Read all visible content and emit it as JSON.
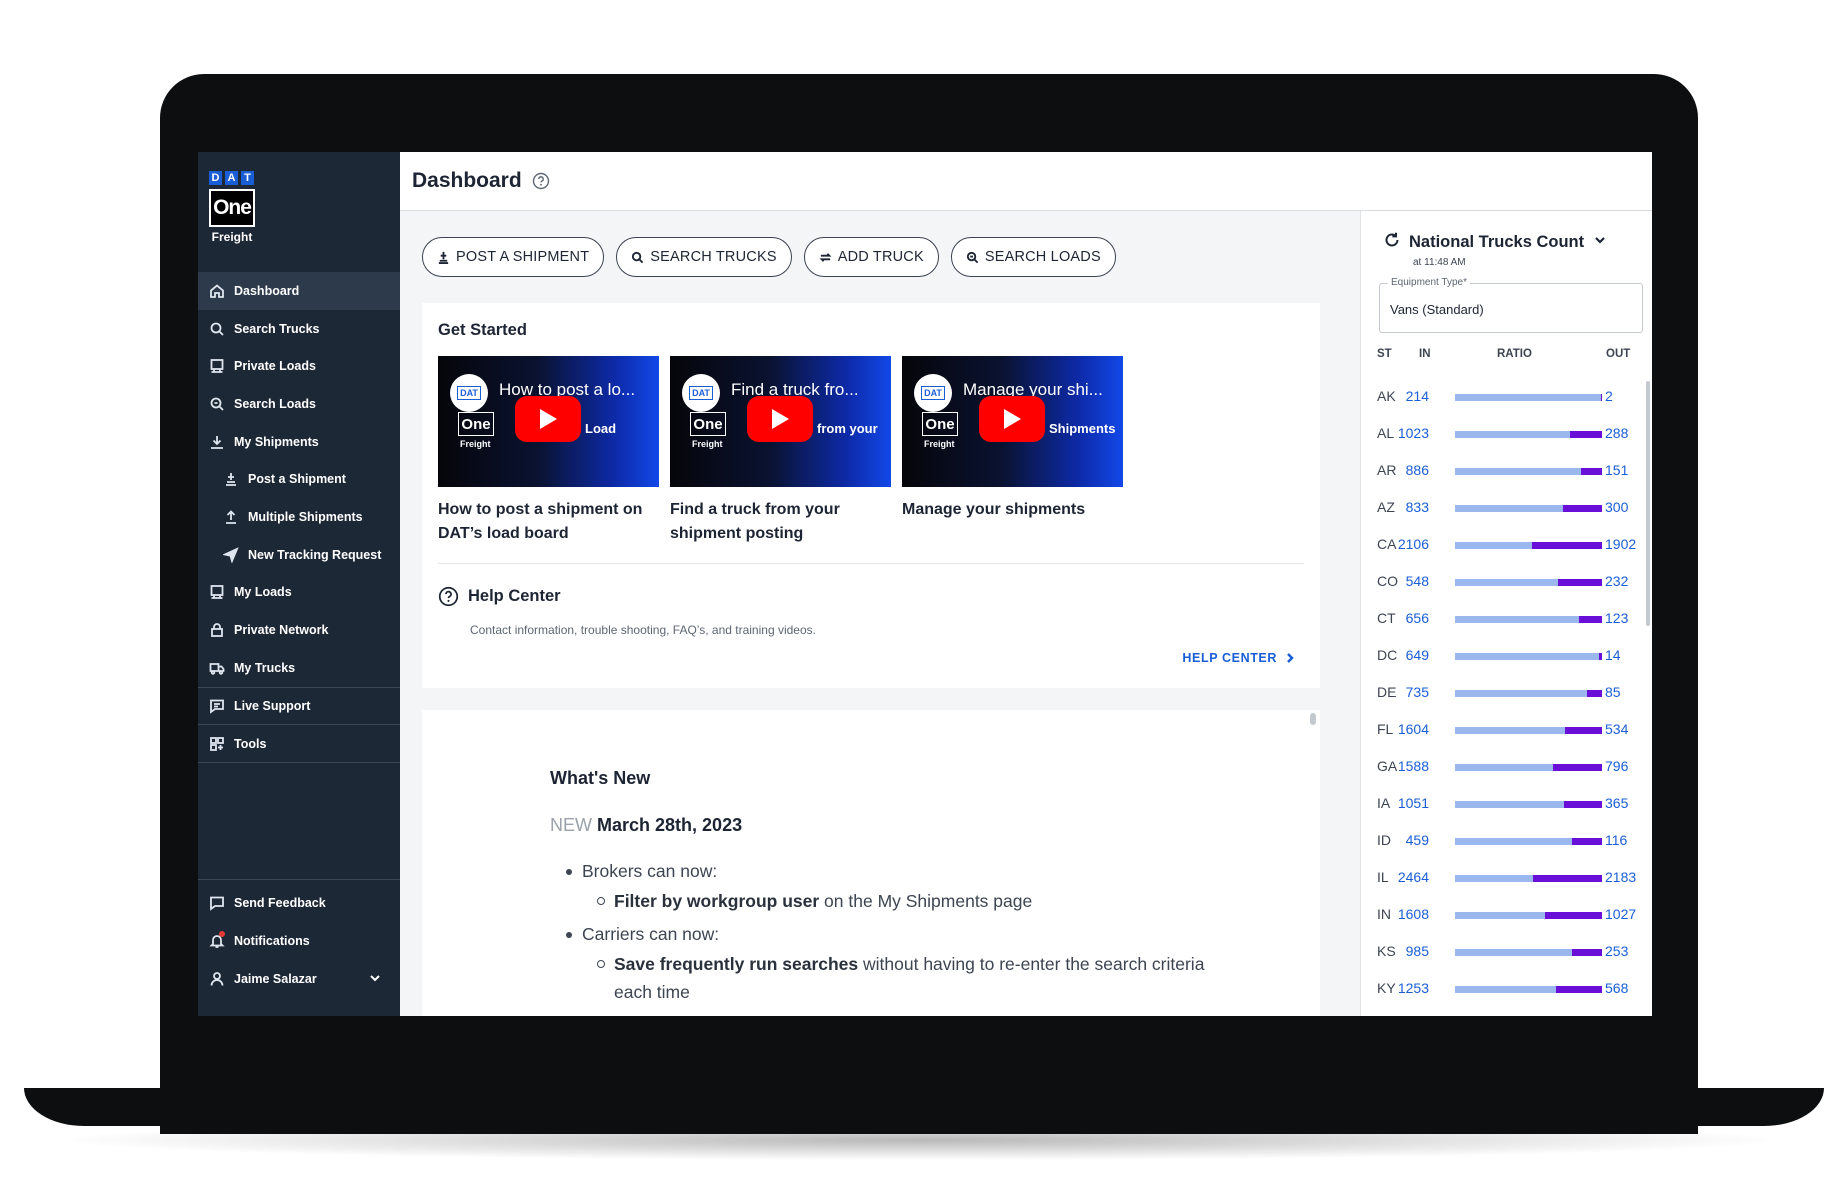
{
  "sidebar": {
    "logo": {
      "dat": [
        "D",
        "A",
        "T"
      ],
      "one": "One",
      "freight": "Freight"
    },
    "items": [
      {
        "label": "Dashboard",
        "icon": "home-icon",
        "active": true
      },
      {
        "label": "Search Trucks",
        "icon": "search-icon"
      },
      {
        "label": "Private Loads",
        "icon": "private-loads-icon"
      },
      {
        "label": "Search Loads",
        "icon": "search-loads-icon"
      },
      {
        "label": "My Shipments",
        "icon": "shipments-icon"
      },
      {
        "label": "Post a Shipment",
        "icon": "post-shipment-icon",
        "sub": true
      },
      {
        "label": "Multiple Shipments",
        "icon": "upload-icon",
        "sub": true
      },
      {
        "label": "New Tracking Request",
        "icon": "navigation-arrow-icon",
        "sub": true
      },
      {
        "label": "My Loads",
        "icon": "my-loads-icon"
      },
      {
        "label": "Private Network",
        "icon": "lock-icon"
      },
      {
        "label": "My Trucks",
        "icon": "truck-icon"
      },
      {
        "label": "Live Support",
        "icon": "chat-icon"
      },
      {
        "label": "Tools",
        "icon": "grid-icon"
      }
    ],
    "bottom": [
      {
        "label": "Send Feedback",
        "icon": "feedback-icon"
      },
      {
        "label": "Notifications",
        "icon": "bell-icon"
      },
      {
        "label": "Jaime Salazar",
        "icon": "user-icon"
      }
    ]
  },
  "header": {
    "title": "Dashboard"
  },
  "actions": [
    {
      "label": "POST A SHIPMENT",
      "icon": "post-icon"
    },
    {
      "label": "SEARCH TRUCKS",
      "icon": "search-icon"
    },
    {
      "label": "ADD TRUCK",
      "icon": "swap-icon"
    },
    {
      "label": "SEARCH LOADS",
      "icon": "search-loads-icon"
    }
  ],
  "get_started": {
    "title": "Get Started",
    "videos": [
      {
        "thumb_title": "How to post a lo...",
        "thumb_sub": "Load",
        "caption": "How to post a shipment on DAT’s load board"
      },
      {
        "thumb_title": "Find a truck fro...",
        "thumb_sub": "from your",
        "caption": "Find a truck from your shipment posting"
      },
      {
        "thumb_title": "Manage your shi...",
        "thumb_sub": "Shipments",
        "caption": "Manage your shipments"
      }
    ],
    "thumb_logo": {
      "dat": "DAT",
      "one": "One",
      "freight": "Freight"
    }
  },
  "help_center": {
    "title": "Help Center",
    "description": "Contact information, trouble shooting, FAQ’s, and training videos.",
    "link": "HELP CENTER"
  },
  "whats_new": {
    "title": "What's New",
    "new_tag": "NEW",
    "date": "March 28th, 2023",
    "brokers": "Brokers can now:",
    "broker_item_bold": "Filter by workgroup user",
    "broker_item_rest": " on the My Shipments page",
    "carriers": "Carriers can now:",
    "carrier_item_bold": "Save frequently run searches",
    "carrier_item_rest": " without having to re-enter the search criteria each time"
  },
  "trucks_panel": {
    "title": "National Trucks Count",
    "time": "at 11:48 AM",
    "equipment_label": "Equipment Type*",
    "equipment_value": "Vans (Standard)",
    "columns": {
      "st": "ST",
      "in": "IN",
      "ratio": "RATIO",
      "out": "OUT"
    },
    "colors": {
      "in_bar": "#9bb8ee",
      "out_bar": "#6a0fd7"
    },
    "rows": [
      {
        "st": "AK",
        "in": 214,
        "out": 2
      },
      {
        "st": "AL",
        "in": 1023,
        "out": 288
      },
      {
        "st": "AR",
        "in": 886,
        "out": 151
      },
      {
        "st": "AZ",
        "in": 833,
        "out": 300
      },
      {
        "st": "CA",
        "in": 2106,
        "out": 1902
      },
      {
        "st": "CO",
        "in": 548,
        "out": 232
      },
      {
        "st": "CT",
        "in": 656,
        "out": 123
      },
      {
        "st": "DC",
        "in": 649,
        "out": 14
      },
      {
        "st": "DE",
        "in": 735,
        "out": 85
      },
      {
        "st": "FL",
        "in": 1604,
        "out": 534
      },
      {
        "st": "GA",
        "in": 1588,
        "out": 796
      },
      {
        "st": "IA",
        "in": 1051,
        "out": 365
      },
      {
        "st": "ID",
        "in": 459,
        "out": 116
      },
      {
        "st": "IL",
        "in": 2464,
        "out": 2183
      },
      {
        "st": "IN",
        "in": 1608,
        "out": 1027
      },
      {
        "st": "KS",
        "in": 985,
        "out": 253
      },
      {
        "st": "KY",
        "in": 1253,
        "out": 568
      }
    ]
  }
}
